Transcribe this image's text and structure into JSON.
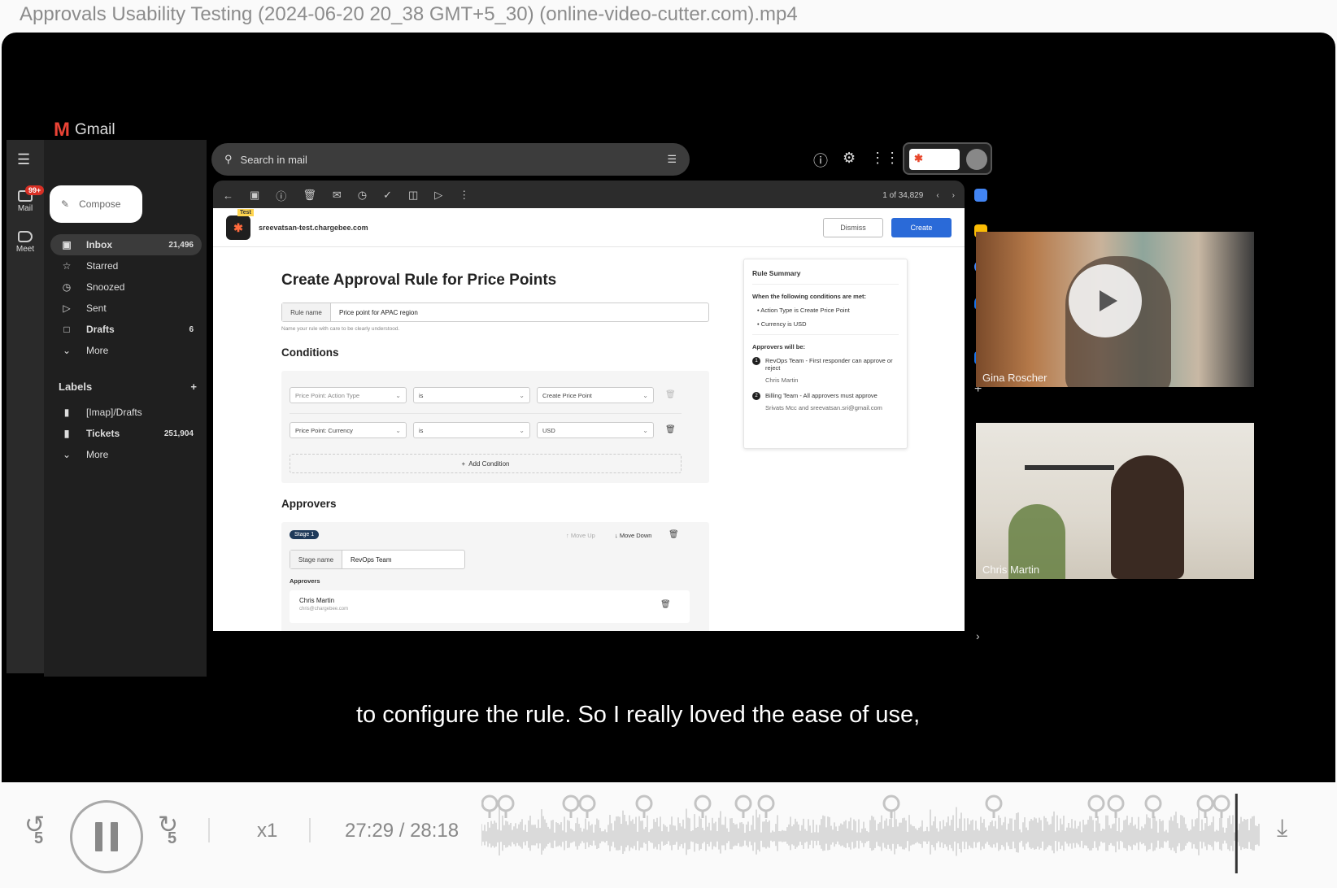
{
  "window": {
    "title": "Approvals Usability Testing (2024-06-20 20_38 GMT+5_30) (online-video-cutter.com).mp4"
  },
  "gmail": {
    "app_name": "Gmail",
    "rail": {
      "mail_label": "Mail",
      "mail_badge": "99+",
      "meet_label": "Meet"
    },
    "compose_label": "Compose",
    "nav": [
      {
        "label": "Inbox",
        "count": "21,496",
        "icon": "inbox-icon"
      },
      {
        "label": "Starred",
        "count": "",
        "icon": "star-icon"
      },
      {
        "label": "Snoozed",
        "count": "",
        "icon": "clock-icon"
      },
      {
        "label": "Sent",
        "count": "",
        "icon": "send-icon"
      },
      {
        "label": "Drafts",
        "count": "6",
        "icon": "draft-icon"
      },
      {
        "label": "More",
        "count": "",
        "icon": "chevron-down-icon"
      }
    ],
    "labels_title": "Labels",
    "labels": [
      {
        "label": "[Imap]/Drafts",
        "count": ""
      },
      {
        "label": "Tickets",
        "count": "251,904"
      },
      {
        "label": "More",
        "count": ""
      }
    ],
    "search_placeholder": "Search in mail",
    "pager": "1 of 34,829"
  },
  "app": {
    "site": "sreevatsan-test.chargebee.com",
    "badge": "Test",
    "dismiss_label": "Dismiss",
    "create_label": "Create",
    "heading": "Create Approval Rule for Price Points",
    "rule_name_label": "Rule name",
    "rule_name_value": "Price point for APAC region",
    "rule_name_hint": "Name your rule with care to be clearly understood.",
    "conditions_title": "Conditions",
    "conditions": [
      {
        "field": "Price Point: Action Type",
        "operator": "is",
        "value": "Create Price Point"
      },
      {
        "field": "Price Point: Currency",
        "operator": "is",
        "value": "USD"
      }
    ],
    "add_condition_label": "Add Condition",
    "approvers_title": "Approvers",
    "stage_pill": "Stage 1",
    "move_up_label": "Move Up",
    "move_down_label": "Move Down",
    "stage_name_label": "Stage name",
    "stage_name_value": "RevOps Team",
    "approvers_label": "Approvers",
    "approver_name": "Chris Martin",
    "approver_email": "chris@chargebee.com"
  },
  "summary": {
    "title": "Rule Summary",
    "conditions_intro": "When the following conditions are met:",
    "conditions": [
      "Action Type is Create Price Point",
      "Currency is USD"
    ],
    "approvers_intro": "Approvers will be:",
    "steps": [
      {
        "num": "1",
        "text": "RevOps Team - First responder can approve or reject",
        "sub": "Chris Martin"
      },
      {
        "num": "2",
        "text": "Billing Team - All approvers must approve",
        "sub": "Srivats Mcc and sreevatsan.sri@gmail.com"
      }
    ]
  },
  "participants": [
    {
      "name": "Gina Roscher"
    },
    {
      "name": "Chris Martin"
    }
  ],
  "caption": "to configure the rule. So I really loved the ease of use,",
  "player": {
    "rewind_label": "5",
    "forward_label": "5",
    "speed": "x1",
    "time": "27:29 / 28:18",
    "progress": 0.969,
    "colors": {
      "waveform": "#c4c4c4",
      "playhead": "#333333"
    }
  }
}
